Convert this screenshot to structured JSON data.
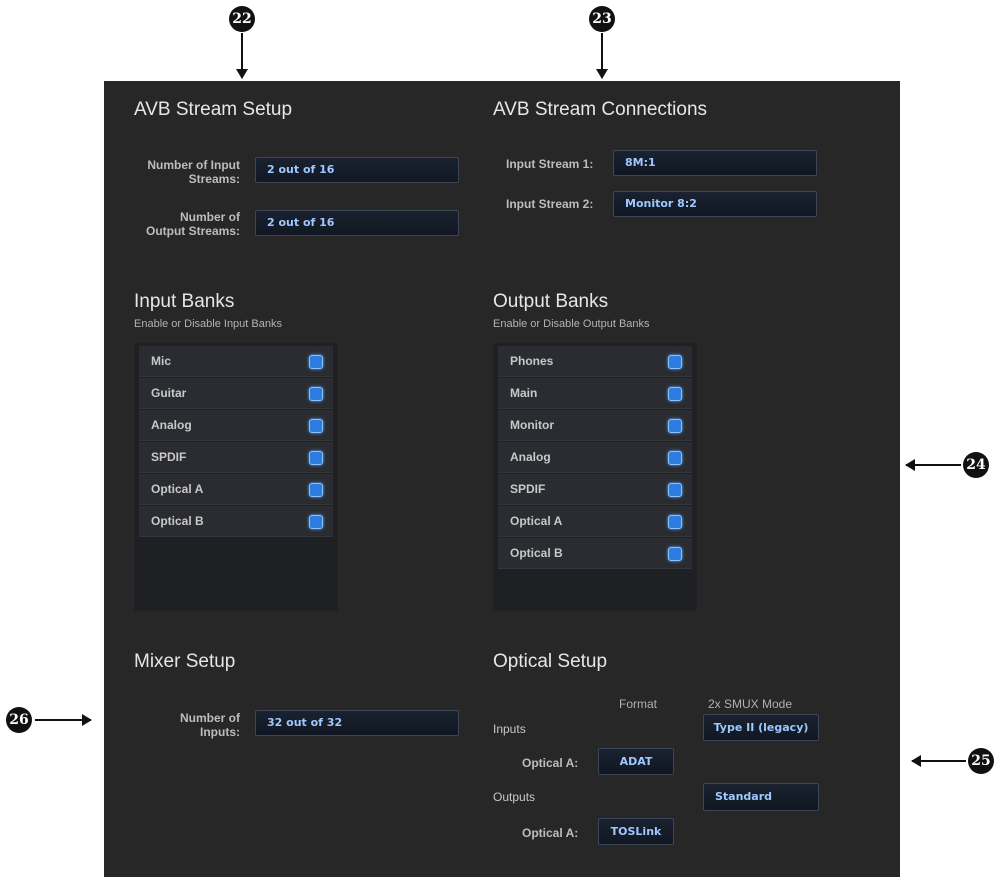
{
  "callouts": {
    "c22": "22",
    "c23": "23",
    "c24": "24",
    "c25": "25",
    "c26": "26"
  },
  "avb_setup": {
    "title": "AVB Stream Setup",
    "input_label_1": "Number of Input",
    "input_label_2": "Streams:",
    "input_value": "2 out of 16",
    "output_label_1": "Number of",
    "output_label_2": "Output Streams:",
    "output_value": "2 out of 16"
  },
  "avb_connections": {
    "title": "AVB Stream Connections",
    "stream1_label": "Input Stream 1:",
    "stream1_value": "8M:1",
    "stream2_label": "Input Stream 2:",
    "stream2_value": "Monitor 8:2"
  },
  "input_banks": {
    "title": "Input Banks",
    "subtitle": "Enable or Disable Input Banks",
    "items": [
      {
        "label": "Mic",
        "enabled": true
      },
      {
        "label": "Guitar",
        "enabled": true
      },
      {
        "label": "Analog",
        "enabled": true
      },
      {
        "label": "SPDIF",
        "enabled": true
      },
      {
        "label": "Optical A",
        "enabled": true
      },
      {
        "label": "Optical B",
        "enabled": true
      }
    ]
  },
  "output_banks": {
    "title": "Output Banks",
    "subtitle": "Enable or Disable Output Banks",
    "items": [
      {
        "label": "Phones",
        "enabled": true
      },
      {
        "label": "Main",
        "enabled": true
      },
      {
        "label": "Monitor",
        "enabled": true
      },
      {
        "label": "Analog",
        "enabled": true
      },
      {
        "label": "SPDIF",
        "enabled": true
      },
      {
        "label": "Optical A",
        "enabled": true
      },
      {
        "label": "Optical B",
        "enabled": true
      }
    ]
  },
  "mixer_setup": {
    "title": "Mixer Setup",
    "inputs_label_1": "Number of",
    "inputs_label_2": "Inputs:",
    "inputs_value": "32 out of 32"
  },
  "optical_setup": {
    "title": "Optical Setup",
    "format_header": "Format",
    "smux_header": "2x SMUX Mode",
    "inputs_label": "Inputs",
    "inputs_smux": "Type II (legacy)",
    "inputs_optical_label": "Optical A:",
    "inputs_optical_format": "ADAT",
    "outputs_label": "Outputs",
    "outputs_smux": "Standard",
    "outputs_optical_label": "Optical A:",
    "outputs_optical_format": "TOSLink"
  },
  "colors": {
    "panel": "#272727",
    "field_text": "#9ec8ff",
    "checkbox": "#2d7de0"
  }
}
